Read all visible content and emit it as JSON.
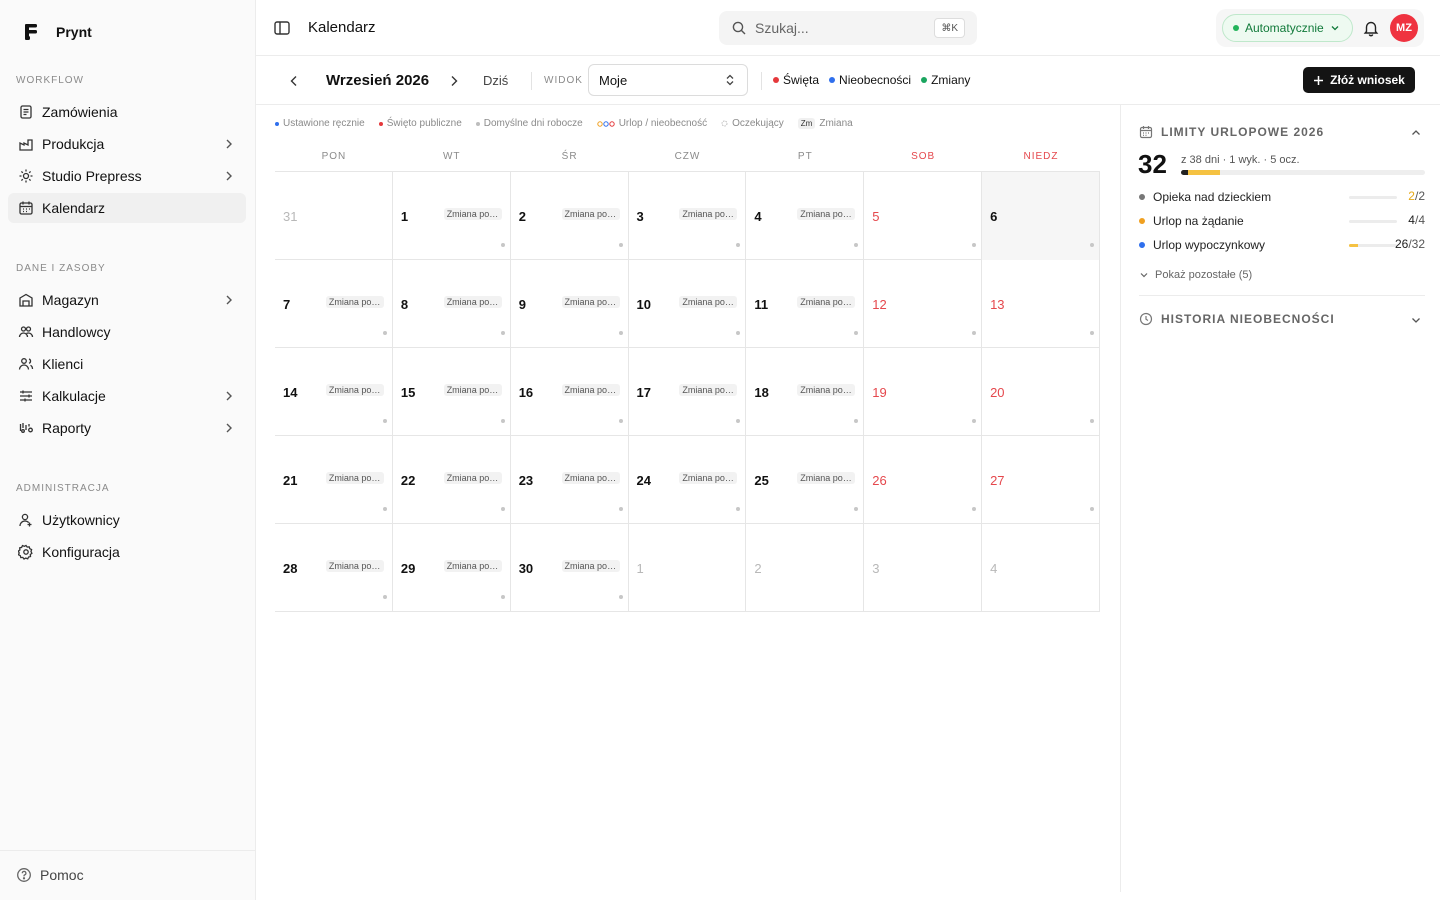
{
  "app": {
    "name": "Prynt"
  },
  "sidebar": {
    "sections": [
      {
        "title": "WORKFLOW"
      },
      {
        "title": "DANE I ZASOBY"
      },
      {
        "title": "ADMINISTRACJA"
      }
    ],
    "items": [
      {
        "label": "Zamówienia",
        "icon": "orders-icon"
      },
      {
        "label": "Produkcja",
        "icon": "production-icon"
      },
      {
        "label": "Studio Prepress",
        "icon": "studio-icon"
      },
      {
        "label": "Kalendarz",
        "icon": "calendar-icon"
      },
      {
        "label": "Magazyn",
        "icon": "warehouse-icon"
      },
      {
        "label": "Handlowcy",
        "icon": "sales-icon"
      },
      {
        "label": "Klienci",
        "icon": "clients-icon"
      },
      {
        "label": "Kalkulacje",
        "icon": "calculations-icon"
      },
      {
        "label": "Raporty",
        "icon": "reports-icon"
      },
      {
        "label": "Użytkownicy",
        "icon": "users-icon"
      },
      {
        "label": "Konfiguracja",
        "icon": "settings-icon"
      }
    ],
    "footer": {
      "help_label": "Pomoc"
    }
  },
  "header": {
    "title": "Kalendarz",
    "search_placeholder": "Szukaj...",
    "search_shortcut": "⌘K",
    "status_label": "Automatycznie",
    "avatar_initials": "MZ"
  },
  "toolbar": {
    "month": "Wrzesień 2026",
    "today_label": "Dziś",
    "view_label": "WIDOK",
    "view_value": "Moje",
    "legend": [
      {
        "label": "Święta",
        "color": "#e5383b"
      },
      {
        "label": "Nieobecności",
        "color": "#2f6fed"
      },
      {
        "label": "Zmiany",
        "color": "#1aa55f"
      }
    ],
    "submit_label": "Złóż wniosek"
  },
  "calendar_legend": {
    "manual": "Ustawione ręcznie",
    "holiday": "Święto publiczne",
    "default_days": "Domyślne dni robocze",
    "leave": "Urlop / nieobecność",
    "pending": "Oczekujący",
    "shift_chip": "Zm",
    "shift": "Zmiana"
  },
  "calendar": {
    "weekdays": [
      "PON",
      "WT",
      "ŚR",
      "CZW",
      "PT",
      "SOB",
      "NIEDZ"
    ],
    "shift_label": "Zmiana por...",
    "weeks": [
      [
        {
          "d": "31",
          "m": true,
          "s": false
        },
        {
          "d": "1",
          "s": true
        },
        {
          "d": "2",
          "s": true
        },
        {
          "d": "3",
          "s": true
        },
        {
          "d": "4",
          "s": true
        },
        {
          "d": "5",
          "w": true
        },
        {
          "d": "6",
          "today": true
        }
      ],
      [
        {
          "d": "7",
          "s": true
        },
        {
          "d": "8",
          "s": true
        },
        {
          "d": "9",
          "s": true
        },
        {
          "d": "10",
          "s": true
        },
        {
          "d": "11",
          "s": true
        },
        {
          "d": "12",
          "w": true
        },
        {
          "d": "13",
          "w": true
        }
      ],
      [
        {
          "d": "14",
          "s": true
        },
        {
          "d": "15",
          "s": true
        },
        {
          "d": "16",
          "s": true
        },
        {
          "d": "17",
          "s": true
        },
        {
          "d": "18",
          "s": true
        },
        {
          "d": "19",
          "w": true
        },
        {
          "d": "20",
          "w": true
        }
      ],
      [
        {
          "d": "21",
          "s": true
        },
        {
          "d": "22",
          "s": true
        },
        {
          "d": "23",
          "s": true
        },
        {
          "d": "24",
          "s": true
        },
        {
          "d": "25",
          "s": true
        },
        {
          "d": "26",
          "w": true
        },
        {
          "d": "27",
          "w": true
        }
      ],
      [
        {
          "d": "28",
          "s": true
        },
        {
          "d": "29",
          "s": true
        },
        {
          "d": "30",
          "s": true
        },
        {
          "d": "1",
          "m": true
        },
        {
          "d": "2",
          "m": true
        },
        {
          "d": "3",
          "m": true
        },
        {
          "d": "4",
          "m": true
        }
      ]
    ]
  },
  "limits": {
    "title": "LIMITY URLOPOWE 2026",
    "remaining": "32",
    "summary": "z 38 dni · 1 wyk. · 5 ocz.",
    "used_fraction": 0.03,
    "pending_fraction": 0.13,
    "lines": [
      {
        "name": "Opieka nad dzieckiem",
        "value": "2",
        "total": "/2",
        "color": "#777777",
        "value_color": "#e6a817",
        "fill": 0
      },
      {
        "name": "Urlop na żądanie",
        "value": "4",
        "total": "/4",
        "color": "#f0a020",
        "value_color": "#222222",
        "fill": 0
      },
      {
        "name": "Urlop wypoczynkowy",
        "value": "26",
        "total": "/32",
        "color": "#2f6fed",
        "value_color": "#222222",
        "fill": 0.19
      }
    ],
    "show_more": "Pokaż pozostałe (5)"
  },
  "history": {
    "title": "HISTORIA NIEOBECNOŚCI"
  }
}
